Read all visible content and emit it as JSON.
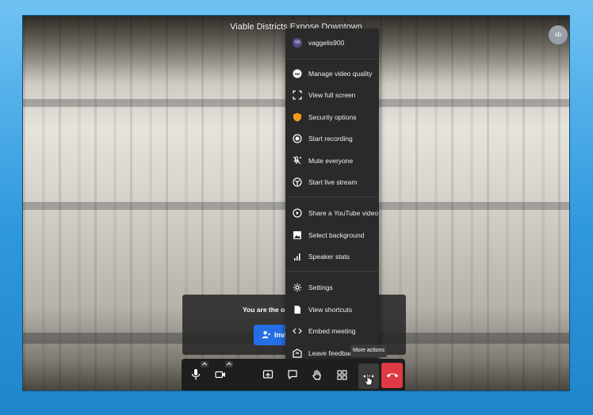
{
  "meeting": {
    "title": "Viable Districts Expose Downtown",
    "avatar_initials": "sb"
  },
  "notice": {
    "text": "You are the on",
    "invite_label": "Invi"
  },
  "menu": {
    "user": {
      "initials": "V9",
      "name": "vaggelis900"
    },
    "items": [
      {
        "label": "Manage video quality",
        "icon": "hd-icon"
      },
      {
        "label": "View full screen",
        "icon": "fullscreen-icon"
      },
      {
        "label": "Security options",
        "icon": "shield-icon"
      },
      {
        "label": "Start recording",
        "icon": "record-icon"
      },
      {
        "label": "Mute everyone",
        "icon": "mute-everyone-icon"
      },
      {
        "label": "Start live stream",
        "icon": "live-stream-icon"
      },
      {
        "label": "Share a YouTube video",
        "icon": "play-circle-icon"
      },
      {
        "label": "Select background",
        "icon": "background-icon"
      },
      {
        "label": "Speaker stats",
        "icon": "stats-icon"
      },
      {
        "label": "Settings",
        "icon": "gear-icon"
      },
      {
        "label": "View shortcuts",
        "icon": "document-icon"
      },
      {
        "label": "Embed meeting",
        "icon": "code-icon"
      },
      {
        "label": "Leave feedback",
        "icon": "feedback-icon"
      }
    ]
  },
  "tooltip": {
    "text": "More actions"
  },
  "toolbar": {
    "buttons": [
      "microphone-icon",
      "camera-icon",
      "share-screen-icon",
      "chat-icon",
      "raise-hand-icon",
      "tile-view-icon",
      "invite-person-icon",
      "more-actions-icon",
      "hangup-icon"
    ]
  },
  "colors": {
    "accent": "#246fe5",
    "hangup": "#dd3a44",
    "security": "#f29b1b",
    "desktop": "#2f98dd"
  }
}
